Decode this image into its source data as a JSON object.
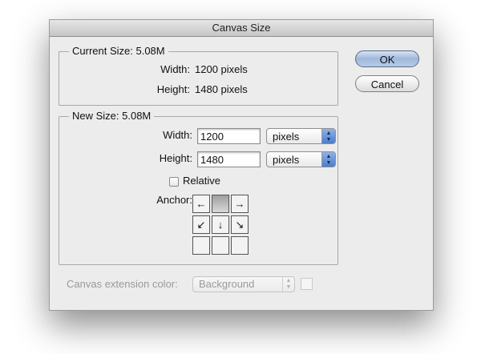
{
  "window": {
    "title": "Canvas Size"
  },
  "current_size": {
    "legend": "Current Size: 5.08M",
    "width_label": "Width:",
    "width_value": "1200 pixels",
    "height_label": "Height:",
    "height_value": "1480 pixels"
  },
  "new_size": {
    "legend": "New Size: 5.08M",
    "width_label": "Width:",
    "width_value": "1200",
    "width_unit": "pixels",
    "height_label": "Height:",
    "height_value": "1480",
    "height_unit": "pixels",
    "relative_label": "Relative",
    "relative_checked": false,
    "anchor_label": "Anchor:",
    "anchor_grid": [
      [
        "←",
        "",
        "→"
      ],
      [
        "↙",
        "↓",
        "↘"
      ],
      [
        "",
        "",
        ""
      ]
    ],
    "anchor_selected": "top-center"
  },
  "buttons": {
    "ok_label": "OK",
    "cancel_label": "Cancel"
  },
  "extension": {
    "label": "Canvas extension color:",
    "value": "Background",
    "enabled": false
  },
  "colors": {
    "dialog_bg": "#ececec",
    "default_button": "#9fb8da",
    "disabled_text": "#9a9a9a"
  },
  "icons": {
    "select_arrows": "updown-arrows-icon",
    "anchor_arrows": [
      "arrow-left-icon",
      "arrow-right-icon",
      "arrow-down-left-icon",
      "arrow-down-icon",
      "arrow-down-right-icon"
    ]
  }
}
